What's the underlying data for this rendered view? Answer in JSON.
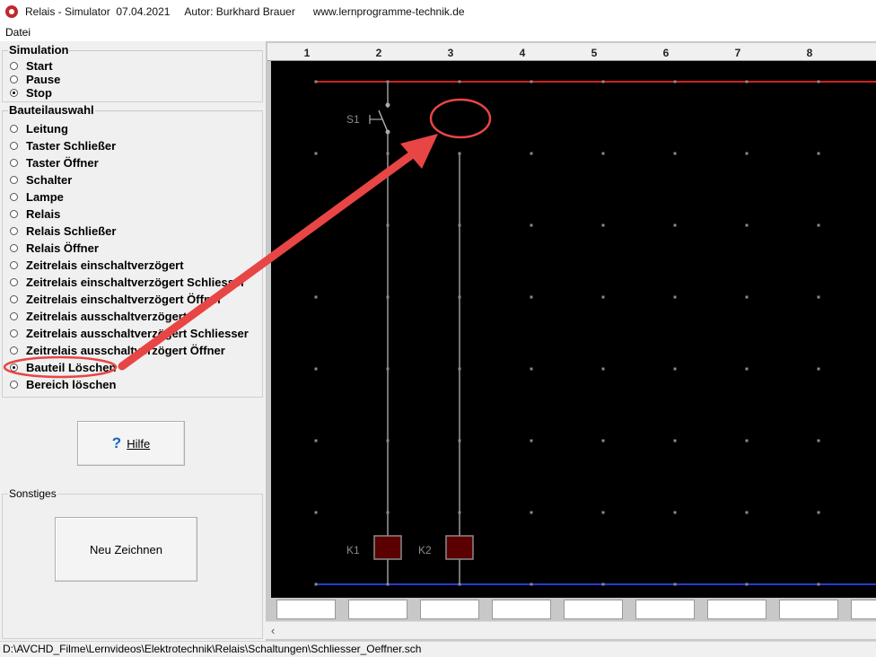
{
  "window": {
    "title": "Relais - Simulator  07.04.2021     Autor: Burkhard Brauer      www.lernprogramme-technik.de"
  },
  "menu": {
    "file": "Datei"
  },
  "simulation": {
    "title": "Simulation",
    "options": [
      {
        "label": "Start",
        "checked": false
      },
      {
        "label": "Pause",
        "checked": false
      },
      {
        "label": "Stop",
        "checked": true
      }
    ]
  },
  "components": {
    "title": "Bauteilauswahl",
    "options": [
      {
        "label": "Leitung",
        "checked": false
      },
      {
        "label": "Taster Schließer",
        "checked": false
      },
      {
        "label": "Taster Öffner",
        "checked": false
      },
      {
        "label": "Schalter",
        "checked": false
      },
      {
        "label": "Lampe",
        "checked": false
      },
      {
        "label": "Relais",
        "checked": false
      },
      {
        "label": "Relais Schließer",
        "checked": false
      },
      {
        "label": "Relais Öffner",
        "checked": false
      },
      {
        "label": "Zeitrelais einschaltverzögert",
        "checked": false
      },
      {
        "label": "Zeitrelais einschaltverzögert Schliesser",
        "checked": false
      },
      {
        "label": "Zeitrelais einschaltverzögert Öffner",
        "checked": false
      },
      {
        "label": "Zeitrelais ausschaltverzögert",
        "checked": false
      },
      {
        "label": "Zeitrelais ausschaltverzögert Schliesser",
        "checked": false
      },
      {
        "label": "Zeitrelais ausschaltverzögert Öffner",
        "checked": false
      },
      {
        "label": "Bauteil Löschen",
        "checked": true
      },
      {
        "label": "Bereich löschen",
        "checked": false
      }
    ]
  },
  "help_button": {
    "label": "Hilfe",
    "icon": "question-icon"
  },
  "misc": {
    "title": "Sonstiges",
    "redraw_button": "Neu Zeichnen"
  },
  "grid": {
    "columns": [
      "1",
      "2",
      "3",
      "4",
      "5",
      "6",
      "7",
      "8"
    ],
    "labels": {
      "switch": "S1",
      "relay1": "K1",
      "relay2": "K2"
    }
  },
  "colors": {
    "top_rail": "#d22020",
    "bottom_rail": "#2040d0",
    "relay_fill": "#5a0000",
    "annotation": "#e84545"
  },
  "status": {
    "path": "D:\\AVCHD_Filme\\Lernvideos\\Elektrotechnik\\Relais\\Schaltungen\\Schliesser_Oeffner.sch"
  }
}
